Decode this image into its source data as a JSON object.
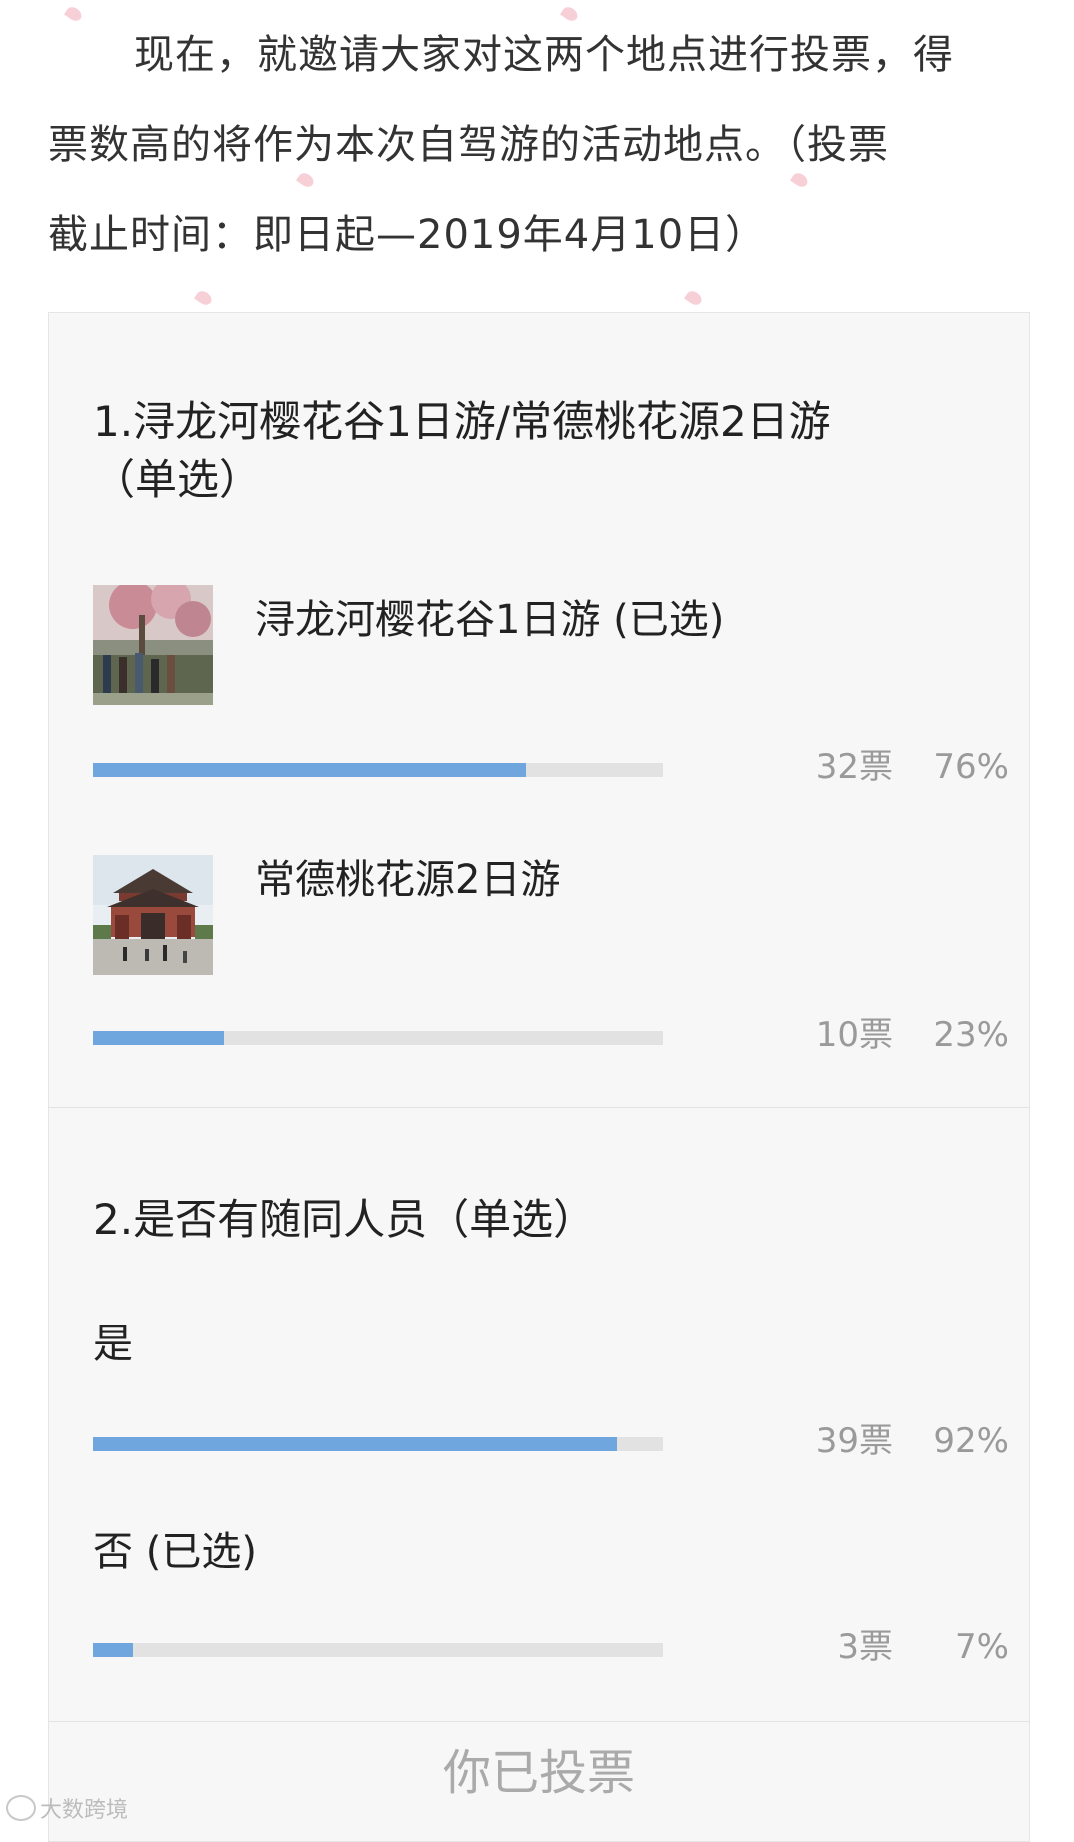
{
  "intro": {
    "line1": "现在，就邀请大家对这两个地点进行投票，得",
    "line2": "票数高的将作为本次自驾游的活动地点。（投票",
    "line3": "截止时间：即日起—2019年4月10日）"
  },
  "colors": {
    "bar_fill": "#6ea6dd",
    "bar_track": "#e2e2e2",
    "card_bg": "#f7f7f8",
    "petal": "#f6c7cf"
  },
  "questions": [
    {
      "title_line1": "1.浔龙河樱花谷1日游/常德桃花源2日游",
      "title_line2": "（单选）",
      "options": [
        {
          "label": "浔龙河樱花谷1日游 (已选)",
          "thumbnail": "cherry-blossom-park-photo",
          "votes": "32票",
          "percent": "76%",
          "fill": 0.76
        },
        {
          "label": "常德桃花源2日游",
          "thumbnail": "chinese-gate-archway-photo",
          "votes": "10票",
          "percent": "23%",
          "fill": 0.23
        }
      ]
    },
    {
      "title_line1": "2.是否有随同人员（单选）",
      "options": [
        {
          "label": "是",
          "votes": "39票",
          "percent": "92%",
          "fill": 0.92
        },
        {
          "label": "否 (已选)",
          "votes": "3票",
          "percent": "7%",
          "fill": 0.07
        }
      ]
    }
  ],
  "footer": {
    "status": "你已投票"
  },
  "watermark": {
    "text": "大数跨境"
  }
}
